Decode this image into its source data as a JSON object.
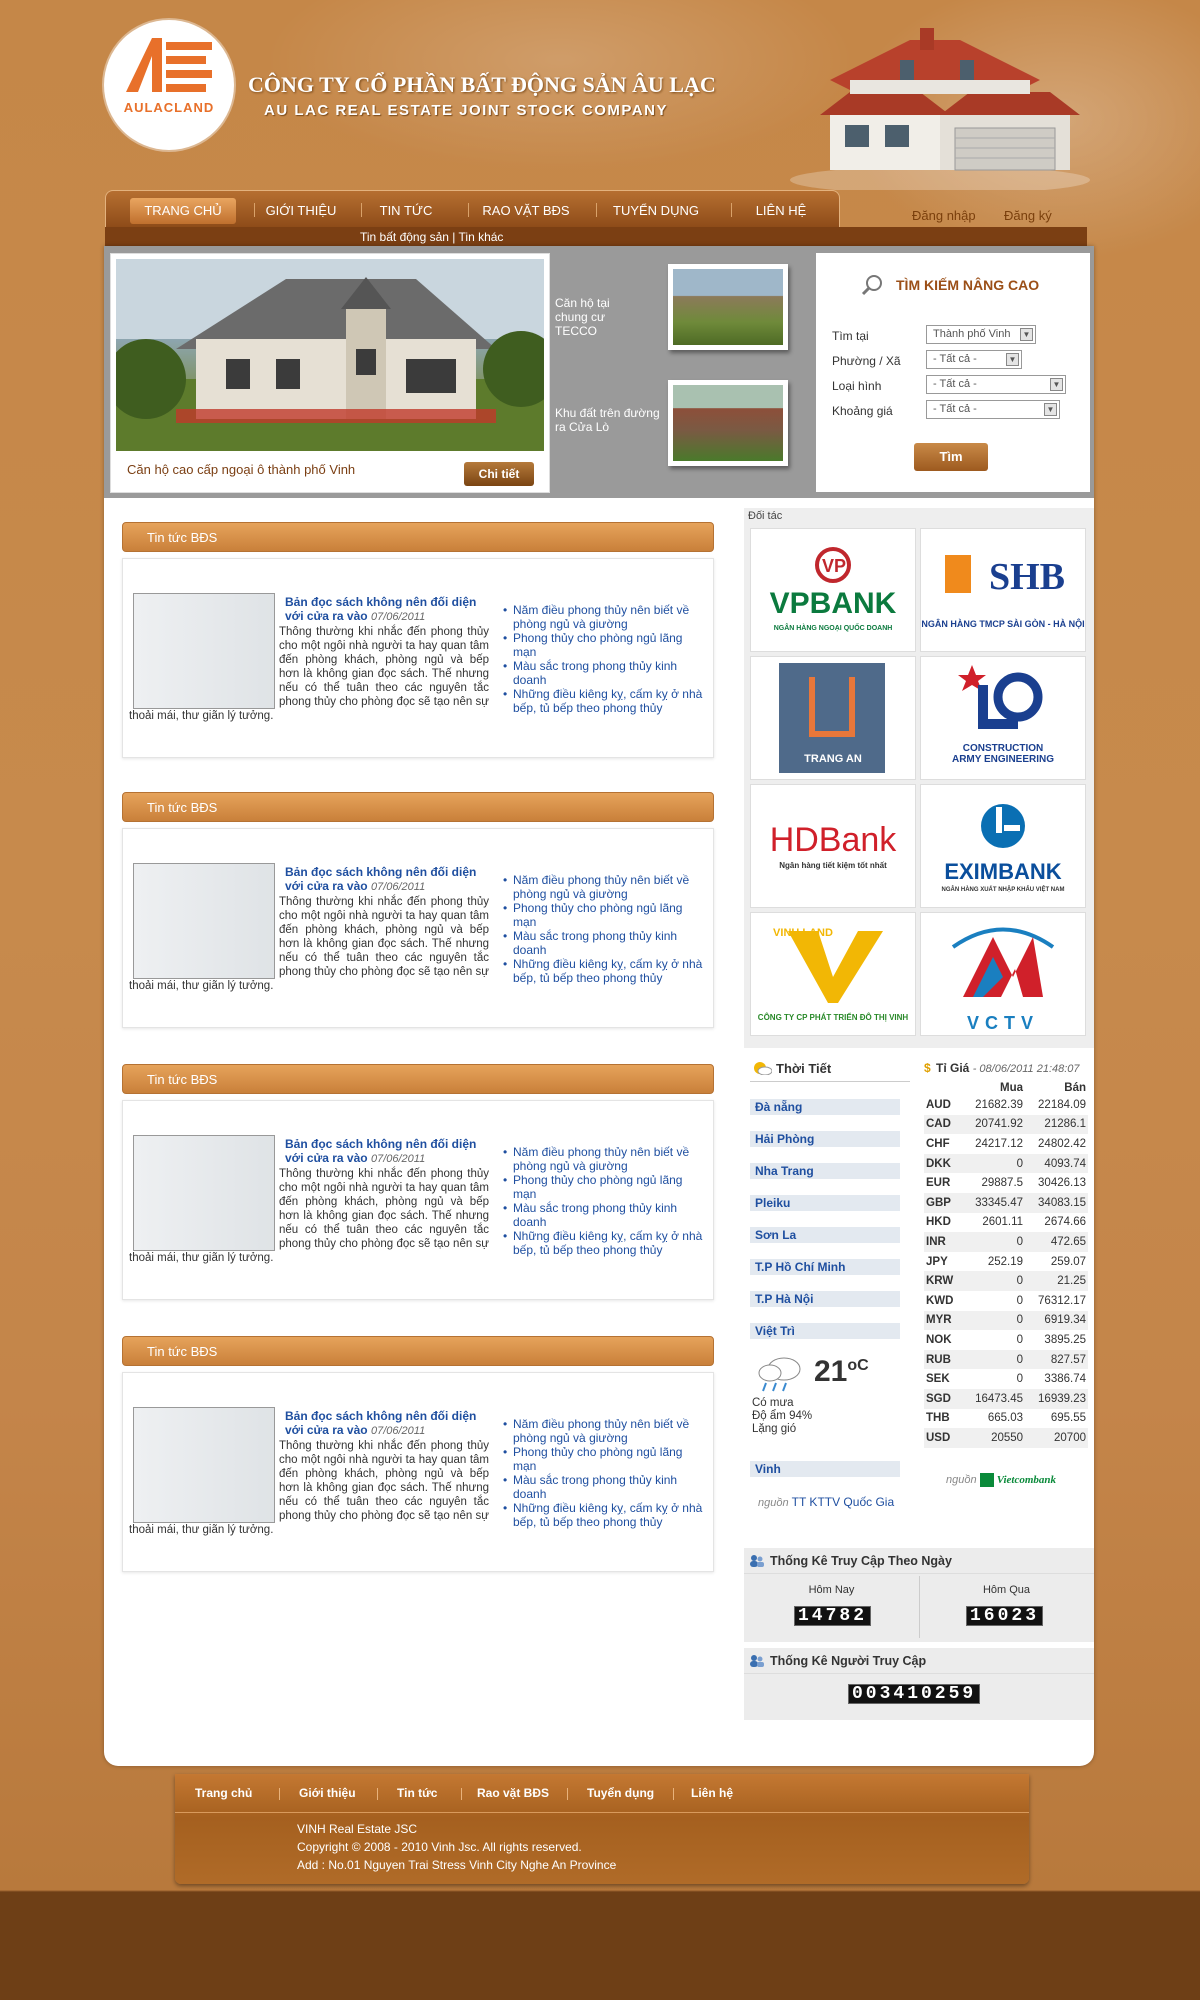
{
  "header": {
    "logo_text": "AULACLAND",
    "company_vn": "CÔNG TY CỔ PHẦN BẤT ĐỘNG SẢN ÂU LẠC",
    "company_en": "AU LAC REAL ESTATE JOINT STOCK COMPANY",
    "login": "Đăng nhập",
    "register": "Đăng ký"
  },
  "nav": {
    "items": [
      "TRANG CHỦ",
      "GIỚI THIỆU",
      "TIN TỨC",
      "RAO VẶT BĐS",
      "TUYỂN DỤNG",
      "LIÊN HỆ"
    ],
    "subnav": "Tin bất động sản | Tin khác"
  },
  "feature": {
    "caption": "Căn hộ cao cấp ngoại ô thành phố Vinh",
    "detail_button": "Chi tiết",
    "thumbs": [
      "Căn hộ tại chung cư TECCO",
      "Khu đất trên đường ra Cửa Lò"
    ]
  },
  "search": {
    "title": "TÌM KIẾM NÂNG CAO",
    "fields": [
      {
        "label": "Tìm tại",
        "value": "Thành phố Vinh"
      },
      {
        "label": "Phường / Xã",
        "value": "- Tất cả -"
      },
      {
        "label": "Loại hình",
        "value": "- Tất cả -"
      },
      {
        "label": "Khoảng giá",
        "value": "- Tất cả -"
      }
    ],
    "button": "Tìm"
  },
  "news": [
    {
      "section": "Tin tức BĐS",
      "title": "Bản đọc sách không nên đối diện với cửa ra vào",
      "date": "07/06/2011",
      "text": "Thông thường khi nhắc đến phong thủy cho một ngôi nhà người ta hay quan tâm đến phòng khách, phòng ngủ và bếp hơn là không gian đọc sách. Thế nhưng nếu có thể tuân theo các nguyên tắc phong thủy cho phòng đọc sẽ tạo nên sự thoải mái, thư giãn lý tưởng.",
      "links": [
        "Năm điều phong thủy nên biết về phòng ngủ và giường",
        "Phong thủy cho phòng ngủ lãng mạn",
        "Màu sắc trong phong thủy kinh doanh",
        "Những điều kiêng kỵ, cấm kỵ ở nhà bếp, tủ bếp theo phong thủy"
      ]
    },
    {
      "section": "Tin tức BĐS",
      "title": "Bản đọc sách không nên đối diện với cửa ra vào",
      "date": "07/06/2011",
      "text": "Thông thường khi nhắc đến phong thủy cho một ngôi nhà người ta hay quan tâm đến phòng khách, phòng ngủ và bếp hơn là không gian đọc sách. Thế nhưng nếu có thể tuân theo các nguyên tắc phong thủy cho phòng đọc sẽ tạo nên sự thoải mái, thư giãn lý tưởng.",
      "links": [
        "Năm điều phong thủy nên biết về phòng ngủ và giường",
        "Phong thủy cho phòng ngủ lãng mạn",
        "Màu sắc trong phong thủy kinh doanh",
        "Những điều kiêng kỵ, cấm kỵ ở nhà bếp, tủ bếp theo phong thủy"
      ]
    },
    {
      "section": "Tin tức BĐS",
      "title": "Bản đọc sách không nên đối diện với cửa ra vào",
      "date": "07/06/2011",
      "text": "Thông thường khi nhắc đến phong thủy cho một ngôi nhà người ta hay quan tâm đến phòng khách, phòng ngủ và bếp hơn là không gian đọc sách. Thế nhưng nếu có thể tuân theo các nguyên tắc phong thủy cho phòng đọc sẽ tạo nên sự thoải mái, thư giãn lý tưởng.",
      "links": [
        "Năm điều phong thủy nên biết về phòng ngủ và giường",
        "Phong thủy cho phòng ngủ lãng mạn",
        "Màu sắc trong phong thủy kinh doanh",
        "Những điều kiêng kỵ, cấm kỵ ở nhà bếp, tủ bếp theo phong thủy"
      ]
    },
    {
      "section": "Tin tức BĐS",
      "title": "Bản đọc sách không nên đối diện với cửa ra vào",
      "date": "07/06/2011",
      "text": "Thông thường khi nhắc đến phong thủy cho một ngôi nhà người ta hay quan tâm đến phòng khách, phòng ngủ và bếp hơn là không gian đọc sách. Thế nhưng nếu có thể tuân theo các nguyên tắc phong thủy cho phòng đọc sẽ tạo nên sự thoải mái, thư giãn lý tưởng.",
      "links": [
        "Năm điều phong thủy nên biết về phòng ngủ và giường",
        "Phong thủy cho phòng ngủ lãng mạn",
        "Màu sắc trong phong thủy kinh doanh",
        "Những điều kiêng kỵ, cấm kỵ ở nhà bếp, tủ bếp theo phong thủy"
      ]
    }
  ],
  "partners": {
    "title": "Đối tác",
    "logos": [
      {
        "name": "VPBANK",
        "sub": "NGÂN HÀNG NGOẠI QUỐC DOANH"
      },
      {
        "name": "SHB",
        "sub": "NGÂN HÀNG TMCP SÀI GÒN - HÀ NỘI"
      },
      {
        "name": "TRANG AN",
        "sub": ""
      },
      {
        "name": "CONSTRUCTION ARMY ENGINEERING",
        "sub": ""
      },
      {
        "name": "HDBank",
        "sub": "Ngân hàng tiết kiệm tốt nhất"
      },
      {
        "name": "EXIMBANK",
        "sub": "NGÂN HÀNG XUẤT NHẬP KHẨU VIỆT NAM"
      },
      {
        "name": "VINH LAND",
        "sub": "CÔNG TY CP PHÁT TRIỂN ĐÔ THỊ VINH"
      },
      {
        "name": "VCTV",
        "sub": ""
      }
    ]
  },
  "weather": {
    "title": "Thời Tiết",
    "cities": [
      "Đà nẵng",
      "Hải Phòng",
      "Nha Trang",
      "Pleiku",
      "Sơn La",
      "T.P Hồ Chí Minh",
      "T.P Hà Nội",
      "Việt Trì"
    ],
    "temperature": "21",
    "unit": "oC",
    "conditions": [
      "Có mưa",
      "Độ ẩm 94%",
      "Lặng gió"
    ],
    "bottom_city": "Vinh",
    "source_label": "nguồn",
    "source": "TT KTTV Quốc Gia"
  },
  "rates": {
    "title": "Tỉ Giá",
    "timestamp": "08/06/2011 21:48:07",
    "headers": [
      "",
      "Mua",
      "Bán"
    ],
    "rows": [
      [
        "AUD",
        "21682.39",
        "22184.09"
      ],
      [
        "CAD",
        "20741.92",
        "21286.1"
      ],
      [
        "CHF",
        "24217.12",
        "24802.42"
      ],
      [
        "DKK",
        "0",
        "4093.74"
      ],
      [
        "EUR",
        "29887.5",
        "30426.13"
      ],
      [
        "GBP",
        "33345.47",
        "34083.15"
      ],
      [
        "HKD",
        "2601.11",
        "2674.66"
      ],
      [
        "INR",
        "0",
        "472.65"
      ],
      [
        "JPY",
        "252.19",
        "259.07"
      ],
      [
        "KRW",
        "0",
        "21.25"
      ],
      [
        "KWD",
        "0",
        "76312.17"
      ],
      [
        "MYR",
        "0",
        "6919.34"
      ],
      [
        "NOK",
        "0",
        "3895.25"
      ],
      [
        "RUB",
        "0",
        "827.57"
      ],
      [
        "SEK",
        "0",
        "3386.74"
      ],
      [
        "SGD",
        "16473.45",
        "16939.23"
      ],
      [
        "THB",
        "665.03",
        "695.55"
      ],
      [
        "USD",
        "20550",
        "20700"
      ]
    ],
    "source_label": "nguồn",
    "source": "Vietcombank"
  },
  "stats": {
    "daily_title": "Thống Kê Truy Cập Theo Ngày",
    "today_label": "Hôm Nay",
    "today": "14782",
    "yesterday_label": "Hôm Qua",
    "yesterday": "16023",
    "total_title": "Thống Kê Người Truy Cập",
    "total": "003410259"
  },
  "footer": {
    "nav": [
      "Trang chủ",
      "Giới thiệu",
      "Tin tức",
      "Rao vặt BĐS",
      "Tuyển dụng",
      "Liên hệ"
    ],
    "line1": "VINH Real Estate JSC",
    "line2": "Copyright © 2008 - 2010 Vinh Jsc. All rights reserved.",
    "line3": "Add : No.01 Nguyen Trai Stress Vinh City Nghe An Province"
  }
}
